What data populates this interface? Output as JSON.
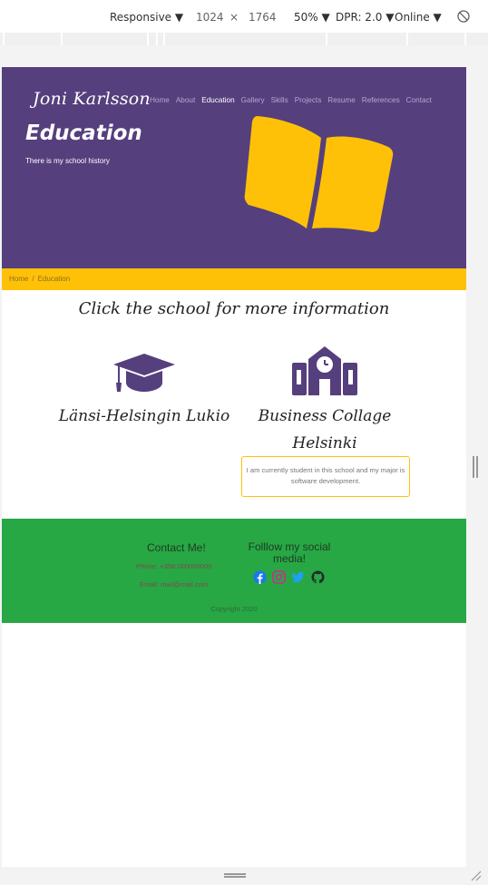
{
  "devtools": {
    "device": "Responsive",
    "width": "1024",
    "times": "×",
    "height": "1764",
    "zoom": "50%",
    "dpr": "DPR: 2.0",
    "network": "Online"
  },
  "site": {
    "brand": "Joni Karlsson",
    "nav": [
      "Home",
      "About",
      "Education",
      "Gallery",
      "Skills",
      "Projects",
      "Resume",
      "References",
      "Contact"
    ],
    "active_nav": "Education",
    "page_title": "Education",
    "page_subtitle": "There is my school history",
    "breadcrumb": [
      "Home",
      "Education"
    ],
    "breadcrumb_sep": "/",
    "section_title": "Click the school for more information",
    "schools": [
      {
        "name": "Länsi-Helsingin Lukio",
        "icon": "graduation-cap-icon"
      },
      {
        "name": "Business Collage Helsinki",
        "icon": "school-building-icon"
      }
    ],
    "info_text": "I am currently student in this school and my major is software development.",
    "footer": {
      "contact_title": "Contact Me!",
      "phone": "Phone: +358 000000000",
      "email": "Email: mail@mail.com",
      "social_title": "Folllow my social media!",
      "social_icons": [
        "facebook-icon",
        "instagram-icon",
        "twitter-icon",
        "github-icon"
      ],
      "copyright": "Copyright 2020"
    }
  },
  "colors": {
    "hero": "#553f7d",
    "accent": "#ffc107",
    "footer": "#28a745",
    "facebook": "#1877f2",
    "instagram": "#c13584",
    "twitter": "#1da1f2",
    "github": "#24292e"
  }
}
